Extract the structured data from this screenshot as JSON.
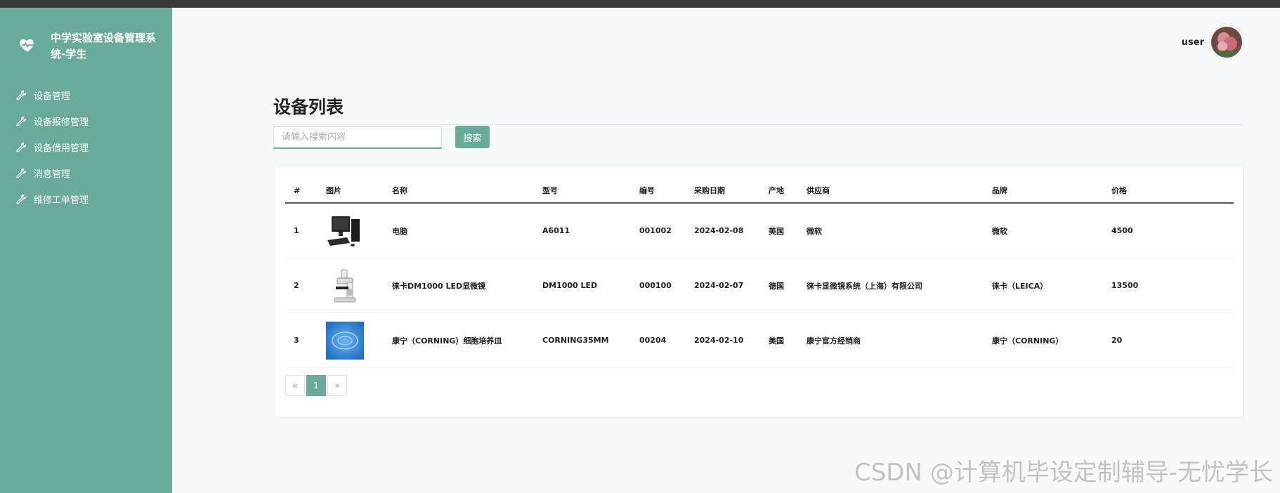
{
  "app": {
    "title": "中学实验室设备管理系统-学生",
    "brand_color": "#69ab9a"
  },
  "sidebar": {
    "items": [
      {
        "label": "设备管理",
        "icon": "wrench-icon"
      },
      {
        "label": "设备报修管理",
        "icon": "wrench-icon"
      },
      {
        "label": "设备借用管理",
        "icon": "wrench-icon"
      },
      {
        "label": "消息管理",
        "icon": "wrench-icon"
      },
      {
        "label": "维修工单管理",
        "icon": "wrench-icon"
      }
    ]
  },
  "header": {
    "user_name": "user"
  },
  "main": {
    "title": "设备列表",
    "search": {
      "placeholder": "请输入搜索内容",
      "value": "",
      "button_label": "搜索"
    },
    "table": {
      "columns": [
        "#",
        "图片",
        "名称",
        "型号",
        "编号",
        "采购日期",
        "产地",
        "供应商",
        "品牌",
        "价格"
      ],
      "rows": [
        {
          "index": "1",
          "image": "computer-image",
          "name": "电脑",
          "model": "A6011",
          "code": "001002",
          "date": "2024-02-08",
          "origin": "美国",
          "supplier": "微软",
          "brand": "微软",
          "price": "4500"
        },
        {
          "index": "2",
          "image": "microscope-image",
          "name": "徕卡DM1000 LED显微镜",
          "model": "DM1000 LED",
          "code": "000100",
          "date": "2024-02-07",
          "origin": "德国",
          "supplier": "徕卡显微镜系统（上海）有限公司",
          "brand": "徕卡（LEICA）",
          "price": "13500"
        },
        {
          "index": "3",
          "image": "petri-dish-image",
          "name": "康宁（CORNING）细胞培养皿",
          "model": "CORNING35MM",
          "code": "00204",
          "date": "2024-02-10",
          "origin": "美国",
          "supplier": "康宁官方经销商",
          "brand": "康宁（CORNING）",
          "price": "20"
        }
      ]
    },
    "pagination": {
      "prev": "«",
      "current": "1",
      "next": "»"
    }
  },
  "watermark": "CSDN @计算机毕设定制辅导-无忧学长"
}
